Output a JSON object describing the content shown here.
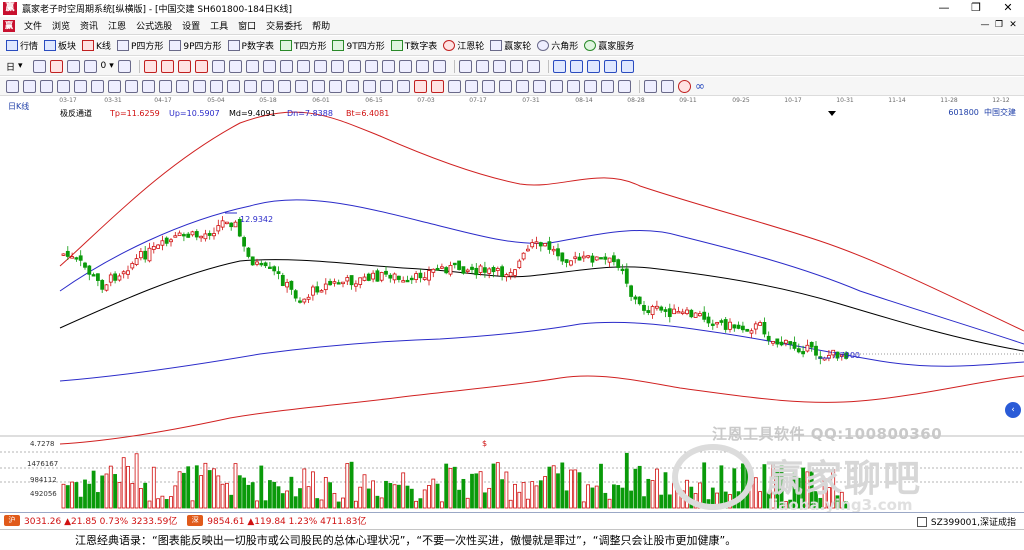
{
  "window": {
    "title": "赢家老子时空周期系统[纵横版] - [中国交建  SH601800-184日K线]",
    "buttons": [
      "—",
      "❐",
      "✕"
    ]
  },
  "menubar": {
    "items": [
      "文件",
      "浏览",
      "资讯",
      "江恩",
      "公式选股",
      "设置",
      "工具",
      "窗口",
      "交易委托",
      "帮助"
    ],
    "mdi_buttons": [
      "—",
      "❐",
      "✕"
    ]
  },
  "toolbar1": {
    "items": [
      "行情",
      "板块",
      "K线",
      "P四方形",
      "9P四方形",
      "P数字表",
      "T四方形",
      "9T四方形",
      "T数字表",
      "江恩轮",
      "赢家轮",
      "六角形",
      "赢家服务"
    ]
  },
  "toolbar2": {
    "items": [
      "日",
      "0"
    ]
  },
  "chart": {
    "period_label": "日K线",
    "indicator": {
      "name": "极反通道",
      "tp": "Tp=11.6259",
      "up": "Up=10.5907",
      "md": "Md=9.4091",
      "dn": "Dn=7.8388",
      "bt": "Bt=6.4081"
    },
    "stock_code": "601800",
    "stock_name": "中国交建",
    "high_label": "12.9342",
    "low_label": "7.7900",
    "dates": [
      "03-17",
      "03-31",
      "04-17",
      "05-04",
      "05-18",
      "06-01",
      "06-15",
      "07-03",
      "07-17",
      "07-31",
      "08-14",
      "08-28",
      "09-11",
      "09-25",
      "10-17",
      "10-31",
      "11-14",
      "11-28",
      "12-12"
    ],
    "volume_axis": [
      "4.7278",
      "1476167",
      "984112",
      "492056"
    ],
    "dollar_mark": "$"
  },
  "chart_data": {
    "type": "candlestick",
    "high": 12.9342,
    "low": 7.79,
    "indicator_levels": {
      "Tp": 11.6259,
      "Up": 10.5907,
      "Md": 9.4091,
      "Dn": 7.8388,
      "Bt": 6.4081
    },
    "volume_ticks": [
      1476167,
      984112,
      492056
    ]
  },
  "watermark": {
    "sub": "江恩工具软件  QQ:100800360",
    "main": "赢家聊吧",
    "url": "liaoba.ying3.com"
  },
  "ticker": {
    "sh_icon": "沪",
    "sh_text": "3031.26 ▲21.85 0.73% 3233.59亿",
    "sz_icon": "深",
    "sz_text": "9854.61 ▲119.84 1.23% 4711.83亿",
    "right_text": "SZ399001,深证成指"
  },
  "banner": {
    "text": "江恩经典语录：“图表能反映出一切股市或公司股民的总体心理状况”，“不要一次性买进，傲慢就是罪过”，“调整只会让股市更加健康”。"
  },
  "colors": {
    "up_candle": "#d01010",
    "down_candle": "#0a9a0a",
    "outer_band": "#d02020",
    "inner_band": "#2b2bc9",
    "mid_line": "#000000"
  }
}
